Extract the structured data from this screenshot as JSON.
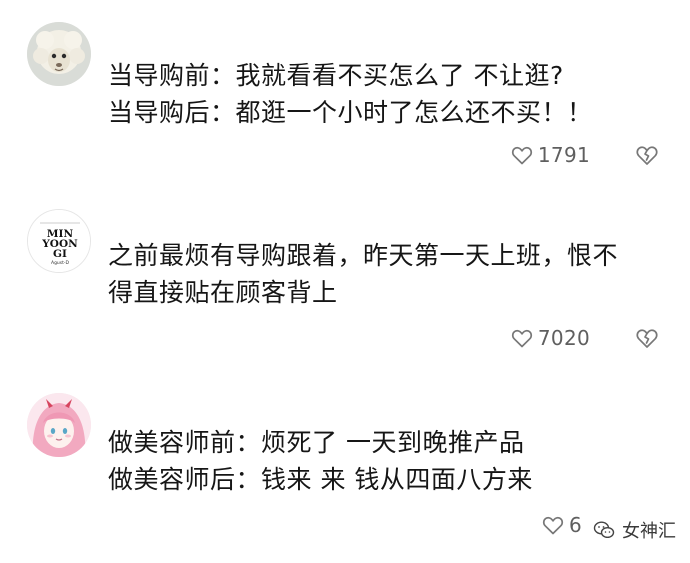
{
  "comments": [
    {
      "avatar": "sheep-avatar",
      "lines": [
        "当导购前：我就看看不买怎么了 不让逛?",
        "当导购后：都逛一个小时了怎么还不买！！"
      ],
      "likes": "1791"
    },
    {
      "avatar": "min-yoongi-text-avatar",
      "avatar_text": {
        "line1": "MIN",
        "line2": "YOON",
        "line3": "GI",
        "sub": "Agust-D"
      },
      "lines": [
        "之前最烦有导购跟着，昨天第一天上班，恨不",
        "得直接贴在顾客背上"
      ],
      "likes": "7020"
    },
    {
      "avatar": "pink-hair-anime-avatar",
      "lines": [
        "做美容师前：烦死了 一天到晚推产品",
        "做美容师后：钱来 来 钱从四面八方来"
      ],
      "likes": "6"
    }
  ],
  "watermark": {
    "icon": "wechat-icon",
    "text": "女神汇"
  },
  "colors": {
    "text": "#161616",
    "meta": "#6b6b6b",
    "background": "#ffffff",
    "avatar_pink": "#f2a9c0"
  }
}
